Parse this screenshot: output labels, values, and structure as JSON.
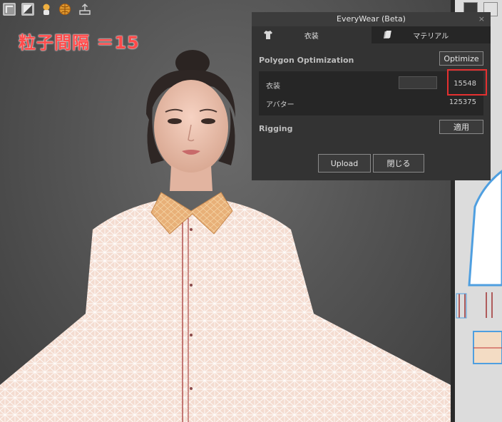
{
  "annotation": {
    "text": "粒子間隔 ＝15",
    "color": "#ff4a4a"
  },
  "toolbar": {
    "icons": [
      "fabric-icon",
      "texture-icon",
      "avatar-icon",
      "globe-icon",
      "export-icon"
    ]
  },
  "panel": {
    "title": "EveryWear (Beta)",
    "close": "×",
    "tabs": [
      {
        "label": "衣装",
        "icon": "tshirt-icon",
        "active": true
      },
      {
        "label": "マテリアル",
        "icon": "fabric-swatch-icon",
        "active": false
      }
    ],
    "polygon": {
      "heading": "Polygon Optimization",
      "optimize_label": "Optimize",
      "garment_label": "衣装",
      "garment_value": "15548",
      "avatar_label": "アバター",
      "avatar_value": "125375"
    },
    "rigging": {
      "heading": "Rigging",
      "apply_label": "適用"
    },
    "upload_label": "Upload",
    "close_label": "閉じる"
  },
  "colors": {
    "panel_bg": "#333333",
    "highlight": "#e53030",
    "pattern_outline": "#4f9fe0"
  }
}
